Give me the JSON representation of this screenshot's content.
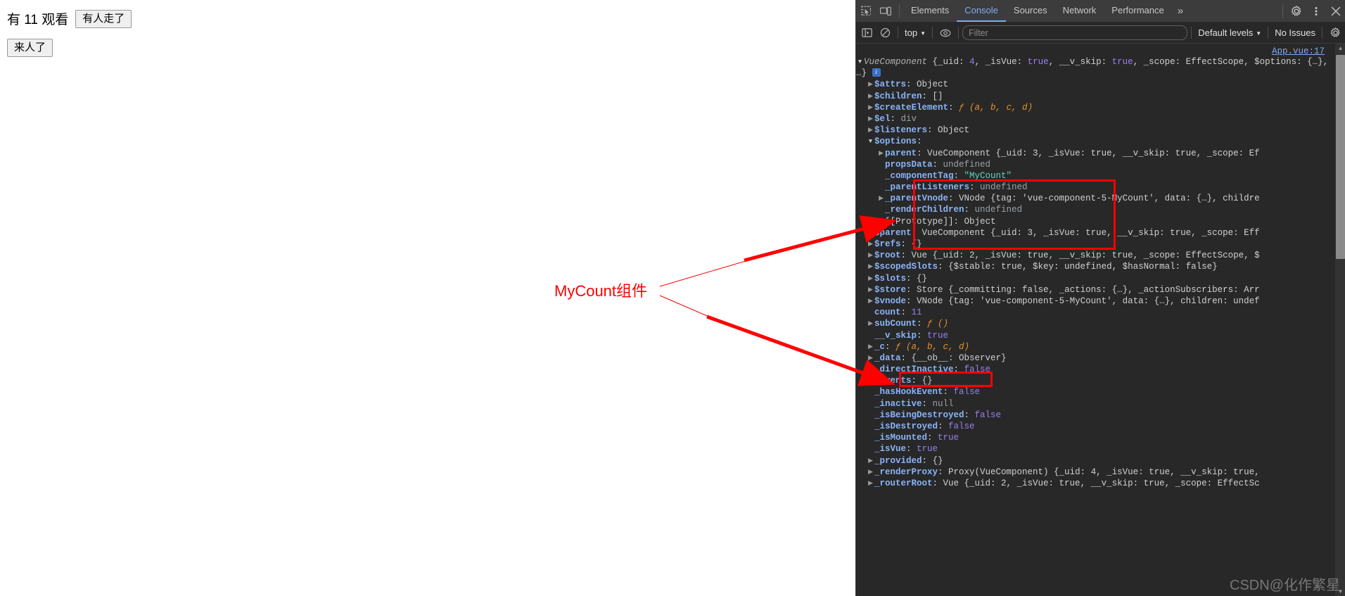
{
  "page": {
    "viewer_text": "有 11 观看",
    "leave_button": "有人走了",
    "arrive_button": "来人了"
  },
  "annotation": {
    "label": "MyCount组件",
    "color": "#fe0000"
  },
  "devtools": {
    "tabs": [
      {
        "label": "Elements",
        "active": false
      },
      {
        "label": "Console",
        "active": true
      },
      {
        "label": "Sources",
        "active": false
      },
      {
        "label": "Network",
        "active": false
      },
      {
        "label": "Performance",
        "active": false
      }
    ],
    "more_tabs_icon": "chevron-double-right-icon",
    "inspect_icon": "inspect-element-icon",
    "device_icon": "device-toolbar-icon",
    "settings_icon": "gear-icon",
    "kebab_icon": "more-options-icon",
    "close_icon": "close-icon",
    "filterbar": {
      "sidebar_icon": "console-sidebar-icon",
      "clear_icon": "clear-console-icon",
      "context_value": "top",
      "eye_icon": "live-expression-icon",
      "filter_placeholder": "Filter",
      "filter_value": "",
      "levels_value": "Default levels",
      "issues_label": "No Issues",
      "console_settings_icon": "gear-icon"
    },
    "source_link": "App.vue:17",
    "watermark": "CSDN@化作繁星",
    "scrollbar": {
      "up_arrow": "▲",
      "down_arrow": "▼"
    }
  },
  "console_tree": {
    "header": {
      "marker": "▼",
      "text_parts": [
        {
          "t": "VueComponent ",
          "c": "t-italic"
        },
        {
          "t": "{_uid: ",
          "c": "t-plain"
        },
        {
          "t": "4",
          "c": "t-num"
        },
        {
          "t": ", _isVue: ",
          "c": "t-plain"
        },
        {
          "t": "true",
          "c": "t-bool"
        },
        {
          "t": ", __v_skip: ",
          "c": "t-plain"
        },
        {
          "t": "true",
          "c": "t-bool"
        },
        {
          "t": ", _scope: EffectScope, $options: {…}, …}",
          "c": "t-plain"
        }
      ],
      "line1": "VueComponent {_uid: 4, _isVue: true, __v_skip: true, _scope: EffectScope,",
      "line2": "$options: {…}, …}",
      "info": "i"
    },
    "rows": [
      {
        "indent": 1,
        "tri": "closed",
        "key": "$attrs",
        "sep": ": ",
        "value": "Object",
        "vclass": "t-obj"
      },
      {
        "indent": 1,
        "tri": "closed",
        "key": "$children",
        "sep": ": ",
        "value": "[]",
        "vclass": "t-obj"
      },
      {
        "indent": 1,
        "tri": "closed",
        "key": "$createElement",
        "sep": ": ",
        "value": "ƒ (a, b, c, d)",
        "vclass": "t-fn"
      },
      {
        "indent": 1,
        "tri": "closed",
        "key": "$el",
        "sep": ": ",
        "value": "div",
        "vclass": "t-gray"
      },
      {
        "indent": 1,
        "tri": "closed",
        "key": "$listeners",
        "sep": ": ",
        "value": "Object",
        "vclass": "t-obj"
      },
      {
        "indent": 1,
        "tri": "open",
        "key": "$options",
        "sep": ":",
        "value": "",
        "vclass": "t-obj"
      },
      {
        "indent": 2,
        "tri": "closed",
        "key": "parent",
        "sep": ": ",
        "value": "VueComponent {_uid: 3, _isVue: true, __v_skip: true, _scope: Ef",
        "vclass": "t-plain",
        "boxed": true
      },
      {
        "indent": 2,
        "tri": "blank",
        "key": "propsData",
        "sep": ": ",
        "value": "undefined",
        "vclass": "t-gray",
        "boxed": true
      },
      {
        "indent": 2,
        "tri": "blank",
        "key": "_componentTag",
        "sep": ": ",
        "value": "\"MyCount\"",
        "vclass": "t-str",
        "boxed": true
      },
      {
        "indent": 2,
        "tri": "blank",
        "key": "_parentListeners",
        "sep": ": ",
        "value": "undefined",
        "vclass": "t-gray",
        "boxed": true
      },
      {
        "indent": 2,
        "tri": "closed",
        "key": "_parentVnode",
        "sep": ": ",
        "value": "VNode {tag: 'vue-component-5-MyCount', data: {…}, childre",
        "vclass": "t-plain",
        "boxed": true
      },
      {
        "indent": 2,
        "tri": "blank",
        "key": "_renderChildren",
        "sep": ": ",
        "value": "undefined",
        "vclass": "t-gray",
        "boxed": true
      },
      {
        "indent": 2,
        "tri": "closed",
        "key": "[[Prototype]]",
        "sep": ": ",
        "value": "Object",
        "vclass": "t-obj",
        "proto": true
      },
      {
        "indent": 1,
        "tri": "closed",
        "key": "$parent",
        "sep": ": ",
        "value": "VueComponent {_uid: 3, _isVue: true, __v_skip: true, _scope: Eff",
        "vclass": "t-plain"
      },
      {
        "indent": 1,
        "tri": "closed",
        "key": "$refs",
        "sep": ": ",
        "value": "{}",
        "vclass": "t-obj"
      },
      {
        "indent": 1,
        "tri": "closed",
        "key": "$root",
        "sep": ": ",
        "value": "Vue {_uid: 2, _isVue: true, __v_skip: true, _scope: EffectScope, $",
        "vclass": "t-plain"
      },
      {
        "indent": 1,
        "tri": "closed",
        "key": "$scopedSlots",
        "sep": ": ",
        "value": "{$stable: true, $key: undefined, $hasNormal: false}",
        "vclass": "t-plain"
      },
      {
        "indent": 1,
        "tri": "closed",
        "key": "$slots",
        "sep": ": ",
        "value": "{}",
        "vclass": "t-obj"
      },
      {
        "indent": 1,
        "tri": "closed",
        "key": "$store",
        "sep": ": ",
        "value": "Store {_committing: false, _actions: {…}, _actionSubscribers: Arr",
        "vclass": "t-plain"
      },
      {
        "indent": 1,
        "tri": "closed",
        "key": "$vnode",
        "sep": ": ",
        "value": "VNode {tag: 'vue-component-5-MyCount', data: {…}, children: undef",
        "vclass": "t-plain"
      },
      {
        "indent": 1,
        "tri": "blank",
        "key": "count",
        "sep": ": ",
        "value": "11",
        "vclass": "t-num",
        "boxed2": true
      },
      {
        "indent": 1,
        "tri": "closed",
        "key": "subCount",
        "sep": ": ",
        "value": "ƒ ()",
        "vclass": "t-fn"
      },
      {
        "indent": 1,
        "tri": "blank",
        "key": "__v_skip",
        "sep": ": ",
        "value": "true",
        "vclass": "t-bool"
      },
      {
        "indent": 1,
        "tri": "closed",
        "key": "_c",
        "sep": ": ",
        "value": "ƒ (a, b, c, d)",
        "vclass": "t-fn"
      },
      {
        "indent": 1,
        "tri": "closed",
        "key": "_data",
        "sep": ": ",
        "value": "{__ob__: Observer}",
        "vclass": "t-plain"
      },
      {
        "indent": 1,
        "tri": "blank",
        "key": "_directInactive",
        "sep": ": ",
        "value": "false",
        "vclass": "t-bool"
      },
      {
        "indent": 1,
        "tri": "closed",
        "key": "_events",
        "sep": ": ",
        "value": "{}",
        "vclass": "t-obj"
      },
      {
        "indent": 1,
        "tri": "blank",
        "key": "_hasHookEvent",
        "sep": ": ",
        "value": "false",
        "vclass": "t-bool"
      },
      {
        "indent": 1,
        "tri": "blank",
        "key": "_inactive",
        "sep": ": ",
        "value": "null",
        "vclass": "t-gray"
      },
      {
        "indent": 1,
        "tri": "blank",
        "key": "_isBeingDestroyed",
        "sep": ": ",
        "value": "false",
        "vclass": "t-bool"
      },
      {
        "indent": 1,
        "tri": "blank",
        "key": "_isDestroyed",
        "sep": ": ",
        "value": "false",
        "vclass": "t-bool"
      },
      {
        "indent": 1,
        "tri": "blank",
        "key": "_isMounted",
        "sep": ": ",
        "value": "true",
        "vclass": "t-bool"
      },
      {
        "indent": 1,
        "tri": "blank",
        "key": "_isVue",
        "sep": ": ",
        "value": "true",
        "vclass": "t-bool"
      },
      {
        "indent": 1,
        "tri": "closed",
        "key": "_provided",
        "sep": ": ",
        "value": "{}",
        "vclass": "t-obj"
      },
      {
        "indent": 1,
        "tri": "closed",
        "key": "_renderProxy",
        "sep": ": ",
        "value": "Proxy(VueComponent) {_uid: 4, _isVue: true, __v_skip: true,",
        "vclass": "t-plain"
      },
      {
        "indent": 1,
        "tri": "closed",
        "key": "_routerRoot",
        "sep": ": ",
        "value": "Vue {_uid: 2, _isVue: true, __v_skip: true, _scope: EffectSc",
        "vclass": "t-plain"
      }
    ]
  }
}
